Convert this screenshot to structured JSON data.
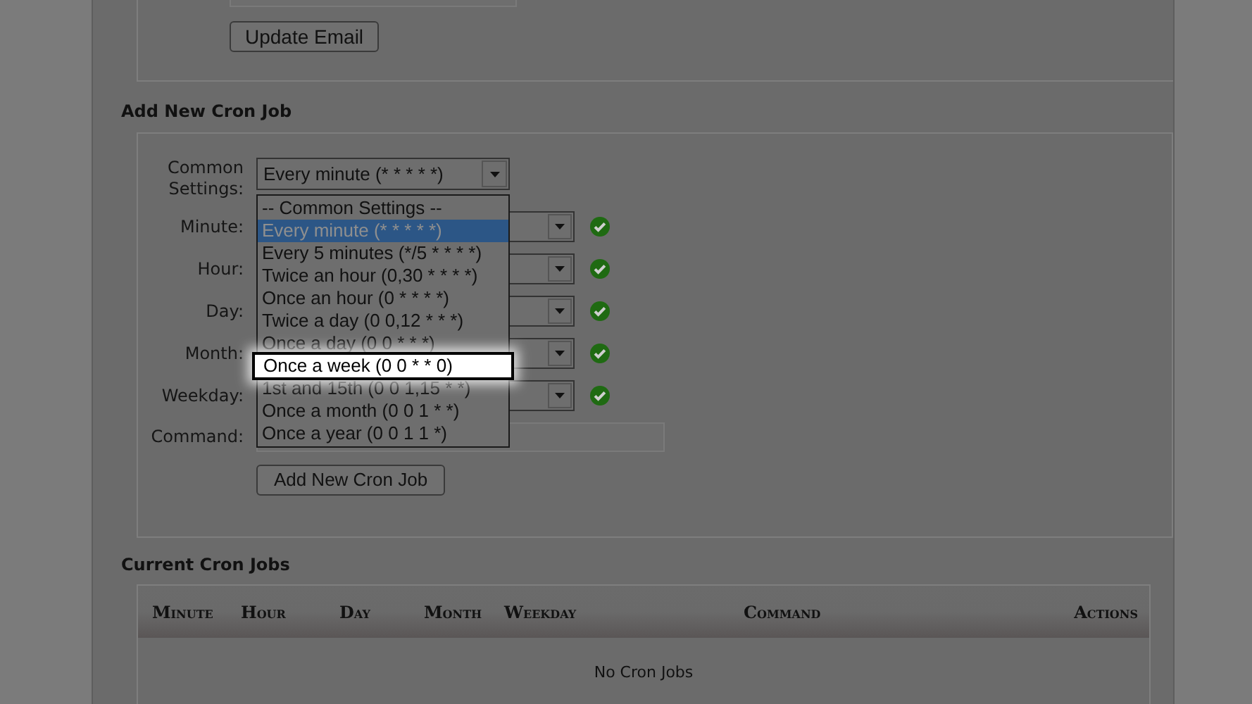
{
  "email_section": {
    "button": "Update Email"
  },
  "add_cron_job": {
    "heading": "Add New Cron Job",
    "common_settings": {
      "label": "Common Settings:",
      "value": "Every minute (* * * * *)",
      "expanded": true,
      "options": [
        {
          "label": "-- Common Settings --",
          "selected": false,
          "highlighted": false
        },
        {
          "label": "Every minute (* * * * *)",
          "selected": true,
          "highlighted": false
        },
        {
          "label": "Every 5 minutes (*/5 * * * *)",
          "selected": false,
          "highlighted": false
        },
        {
          "label": "Twice an hour (0,30 * * * *)",
          "selected": false,
          "highlighted": false
        },
        {
          "label": "Once an hour (0 * * * *)",
          "selected": false,
          "highlighted": false
        },
        {
          "label": "Twice a day (0 0,12 * * *)",
          "selected": false,
          "highlighted": false
        },
        {
          "label": "Once a day (0 0 * * *)",
          "selected": false,
          "highlighted": false
        },
        {
          "label": "Once a week (0 0 * * 0)",
          "selected": false,
          "highlighted": true
        },
        {
          "label": "1st and 15th (0 0 1,15 * *)",
          "selected": false,
          "highlighted": false
        },
        {
          "label": "Once a month (0 0 1 * *)",
          "selected": false,
          "highlighted": false
        },
        {
          "label": "Once a year (0 0 1 1 *)",
          "selected": false,
          "highlighted": false
        }
      ]
    },
    "fields": [
      {
        "label": "Minute:",
        "valid": true
      },
      {
        "label": "Hour:",
        "valid": true
      },
      {
        "label": "Day:",
        "valid": true
      },
      {
        "label": "Month:",
        "valid": true
      },
      {
        "label": "Weekday:",
        "valid": true
      }
    ],
    "command": {
      "label": "Command:"
    },
    "button": "Add New Cron Job"
  },
  "current_cron_jobs": {
    "heading": "Current Cron Jobs",
    "columns": [
      "Minute",
      "Hour",
      "Day",
      "Month",
      "Weekday",
      "Command",
      "Actions"
    ],
    "empty_message": "No Cron Jobs"
  }
}
